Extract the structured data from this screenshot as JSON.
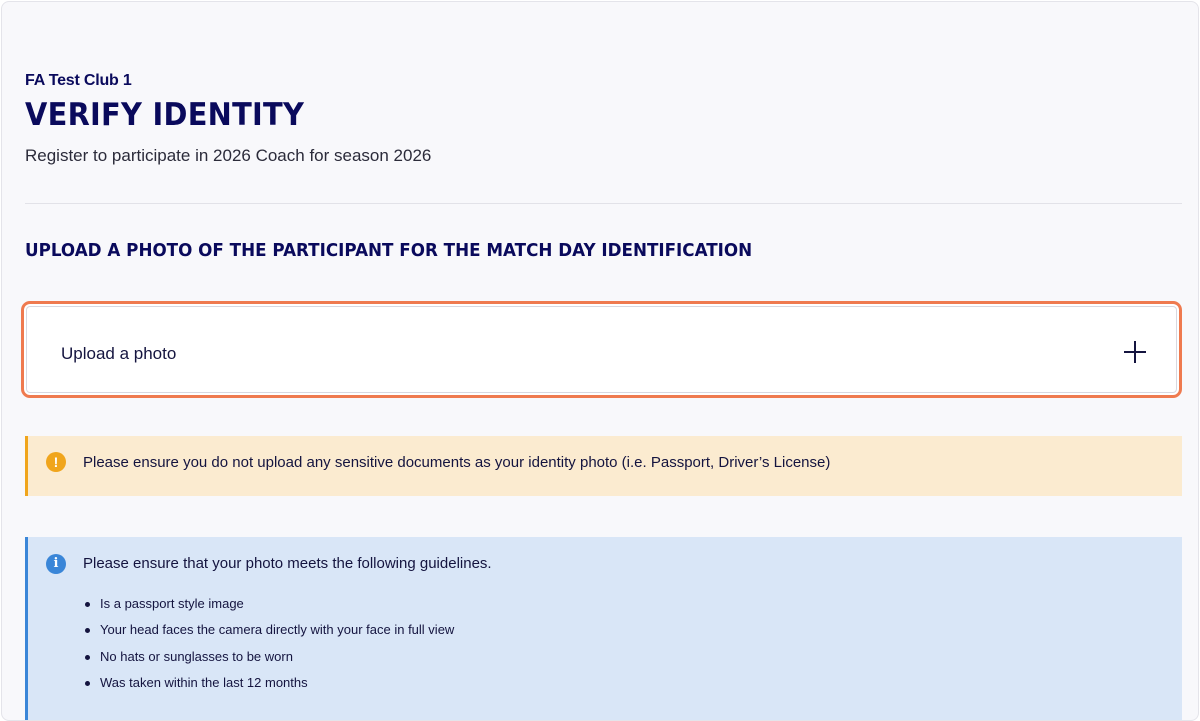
{
  "header": {
    "club_name": "FA Test Club 1",
    "title": "VERIFY IDENTITY",
    "subtitle": "Register to participate in 2026 Coach for season 2026"
  },
  "section": {
    "heading": "UPLOAD A PHOTO OF THE PARTICIPANT FOR THE MATCH DAY IDENTIFICATION"
  },
  "upload": {
    "label": "Upload a photo",
    "icon": "plus-icon",
    "focus_color": "#ef7a4f"
  },
  "warning": {
    "icon_glyph": "!",
    "text": "Please ensure you do not upload any sensitive documents as your identity photo (i.e. Passport, Driver’s License)",
    "color": "#f0a51c"
  },
  "info": {
    "icon_glyph": "i",
    "text": "Please ensure that your photo meets the following guidelines.",
    "guidelines": [
      "Is a passport style image",
      "Your head faces the camera directly with your face in full view",
      "No hats or sunglasses to be worn",
      "Was taken within the last 12 months"
    ],
    "color": "#3a86d8"
  },
  "colors": {
    "brand_navy": "#0a0a5c"
  }
}
